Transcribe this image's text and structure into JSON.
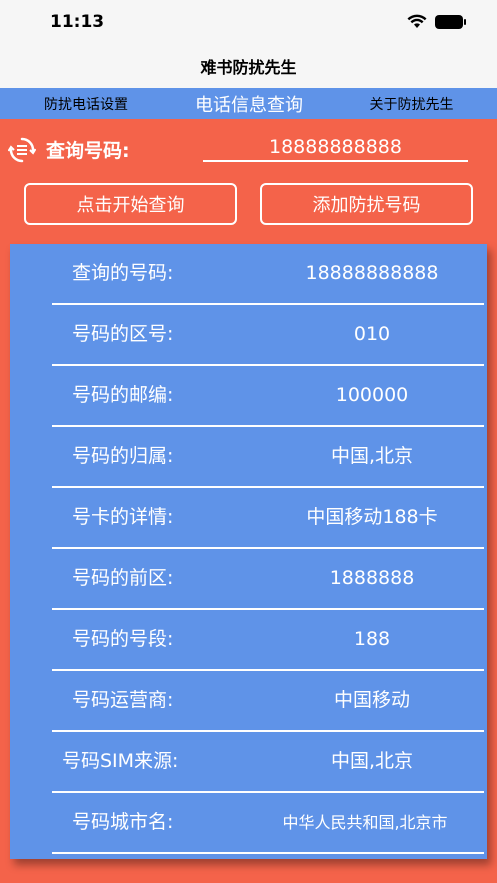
{
  "status_bar": {
    "time": "11:13"
  },
  "nav": {
    "title": "难书防扰先生"
  },
  "tabs": [
    {
      "label": "防扰电话设置"
    },
    {
      "label": "电话信息查询"
    },
    {
      "label": "关于防扰先生"
    }
  ],
  "query": {
    "label": "查询号码:",
    "value": "18888888888"
  },
  "buttons": {
    "start_query": "点击开始查询",
    "add_block": "添加防扰号码"
  },
  "results": [
    {
      "label": "查询的号码:",
      "value": "18888888888"
    },
    {
      "label": "号码的区号:",
      "value": "010"
    },
    {
      "label": "号码的邮编:",
      "value": "100000"
    },
    {
      "label": "号码的归属:",
      "value": "中国,北京"
    },
    {
      "label": "号卡的详情:",
      "value": "中国移动188卡"
    },
    {
      "label": "号码的前区:",
      "value": "1888888"
    },
    {
      "label": "号码的号段:",
      "value": "188"
    },
    {
      "label": "号码运营商:",
      "value": "中国移动"
    },
    {
      "label": "号码SIM来源:",
      "value": "中国,北京"
    },
    {
      "label": "号码城市名:",
      "value": "中华人民共和国,北京市"
    }
  ],
  "colors": {
    "background": "#f4634a",
    "accent_blue": "#5f93e8",
    "text_white": "#ffffff"
  },
  "icons": {
    "wifi": "wifi-icon",
    "battery": "battery-icon",
    "refresh": "refresh-list-icon"
  }
}
